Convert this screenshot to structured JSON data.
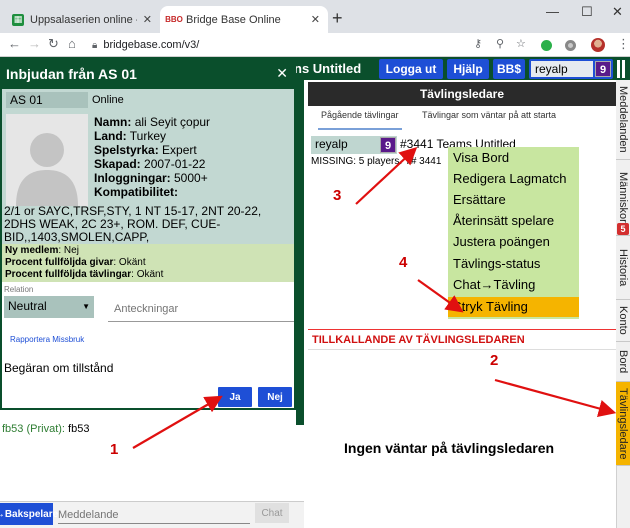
{
  "browser": {
    "tabs": [
      {
        "title": "Uppsalaserien online - Google Sh",
        "icon": "sheets-icon",
        "active": false
      },
      {
        "title": "Bridge Base Online",
        "icon": "bbo-icon",
        "active": true
      }
    ],
    "new_tab": "+",
    "window_controls": {
      "minimize": "—",
      "maximize": "☐",
      "close": "✕"
    },
    "url": "bridgebase.com/v3/"
  },
  "topbar": {
    "title": "ns Untitled",
    "logout": "Logga ut",
    "help": "Hjälp",
    "bbs": "BB$",
    "username": "reyalp",
    "user_badge": "9"
  },
  "dialog": {
    "title": "Inbjudan från AS 01",
    "close": "✕",
    "account": "AS 01",
    "account_status": "Online",
    "fields": {
      "name_label": "Namn:",
      "name": "ali Seyit çopur",
      "country_label": "Land:",
      "country": "Turkey",
      "level_label": "Spelstyrka:",
      "level": "Expert",
      "created_label": "Skapad:",
      "created": "2007-01-22",
      "logins_label": "Inloggningar:",
      "logins": "5000+",
      "compat_label": "Kompatibilitet:"
    },
    "conventions": "2/1 or SAYC,TRSF,STY, 1 NT 15-17, 2NT 20-22, 2DHS WEAK, 2C 23+, ROM. DEF, CUE-BID,,1403,SMOLEN,CAPP,",
    "new_member_label": "Ny medlem",
    "new_member": "Nej",
    "completed_dealer_label": "Procent fullföljda givar",
    "completed_dealer": "Okänt",
    "completed_tournaments_label": "Procent fullföljda tävlingar",
    "completed_tournaments": "Okänt",
    "relation_label": "Relation",
    "relation_value": "Neutral",
    "notes_placeholder": "Anteckningar",
    "report_link": "Rapportera Missbruk",
    "request_text": "Begäran om tillstånd",
    "yes": "Ja",
    "no": "Nej"
  },
  "chat": {
    "sender": "fb53 (Privat):",
    "message": "fb53",
    "back_button": "→Bakspelare",
    "input_placeholder": "Meddelande",
    "send": "Chat"
  },
  "director": {
    "header": "Tävlingsledare",
    "subtabs": [
      "Pågående tävlingar",
      "Tävlingar som väntar på att starta"
    ],
    "player": "reyalp",
    "player_badge": "9",
    "team_text": "#3441 Teams Untitled",
    "missing_text": "MISSING: 5 players. T# 3441",
    "menu": [
      "Visa Bord",
      "Redigera Lagmatch",
      "Ersättare",
      "Återinsätt spelare",
      "Justera poängen",
      "Tävlings-status",
      "Chat→Tävling",
      "Stryk Tävling"
    ],
    "menu_highlight_color": "#f5b400",
    "call_header": "TILLKALLANDE AV TÄVLINGSLEDAREN",
    "waiting": "Ingen väntar på tävlingsledaren"
  },
  "side_tabs": [
    {
      "label": "Meddelanden"
    },
    {
      "label": "Människor",
      "badge": "5"
    },
    {
      "label": "Historia"
    },
    {
      "label": "Konto"
    },
    {
      "label": "Bord"
    },
    {
      "label": "Tävlingsledare",
      "active": true
    }
  ],
  "annotations": [
    "1",
    "2",
    "3",
    "4"
  ],
  "colors": {
    "bbo_green": "#0a4f2c",
    "button_blue": "#1e4fd6",
    "annotation_red": "#cc0000"
  }
}
